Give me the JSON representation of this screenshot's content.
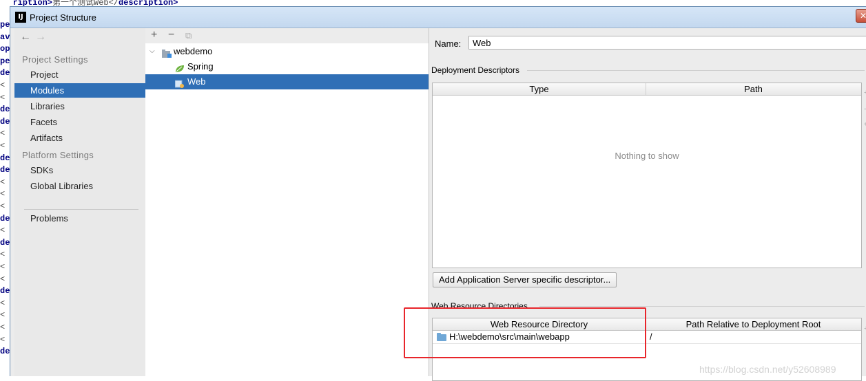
{
  "background": {
    "top_fragment_a": "scription>",
    "top_fragment_b": "第一个测试Web</",
    "top_fragment_c": "description>",
    "left_fragments": [
      "pe",
      "av",
      "op",
      "pe",
      "de",
      "<",
      "<",
      "de",
      "de",
      "<",
      "<",
      "de",
      "de",
      "<",
      "<",
      "<",
      "de",
      "<",
      "de",
      "<",
      "<",
      "<",
      "de",
      "<",
      "<",
      "<",
      "<",
      "de"
    ]
  },
  "window": {
    "title": "Project Structure",
    "app_icon_text": "IJ",
    "close_glyph": "✕"
  },
  "nav": {
    "back_glyph": "←",
    "forward_glyph": "→",
    "project_settings_header": "Project Settings",
    "project_settings_items": [
      "Project",
      "Modules",
      "Libraries",
      "Facets",
      "Artifacts"
    ],
    "platform_settings_header": "Platform Settings",
    "platform_settings_items": [
      "SDKs",
      "Global Libraries"
    ],
    "problems_label": "Problems",
    "selected": "Modules"
  },
  "tree": {
    "toolbar": {
      "add": "+",
      "remove": "−",
      "copy": "⧉"
    },
    "root": {
      "label": "webdemo",
      "expanded": true
    },
    "children": [
      {
        "label": "Spring",
        "icon": "spring-leaf-icon"
      },
      {
        "label": "Web",
        "icon": "web-facet-icon",
        "selected": true
      }
    ]
  },
  "detail": {
    "name_label": "Name:",
    "name_value": "Web",
    "deployment_descriptors_title": "Deployment Descriptors",
    "descriptor_table": {
      "columns": [
        "Type",
        "Path"
      ],
      "empty_text": "Nothing to show"
    },
    "add_descriptor_button": "Add Application Server specific descriptor...",
    "web_resource_title": "Web Resource Directories",
    "web_resource_table": {
      "columns": [
        "Web Resource Directory",
        "Path Relative to Deployment Root"
      ],
      "rows": [
        {
          "directory": "H:\\webdemo\\src\\main\\webapp",
          "relative_path": "/"
        }
      ]
    },
    "side_tool_glyphs": [
      "+",
      "−",
      "✎"
    ]
  },
  "annotation": {
    "color": "#e8252b"
  },
  "watermark": "https://blog.csdn.net/y52608989"
}
